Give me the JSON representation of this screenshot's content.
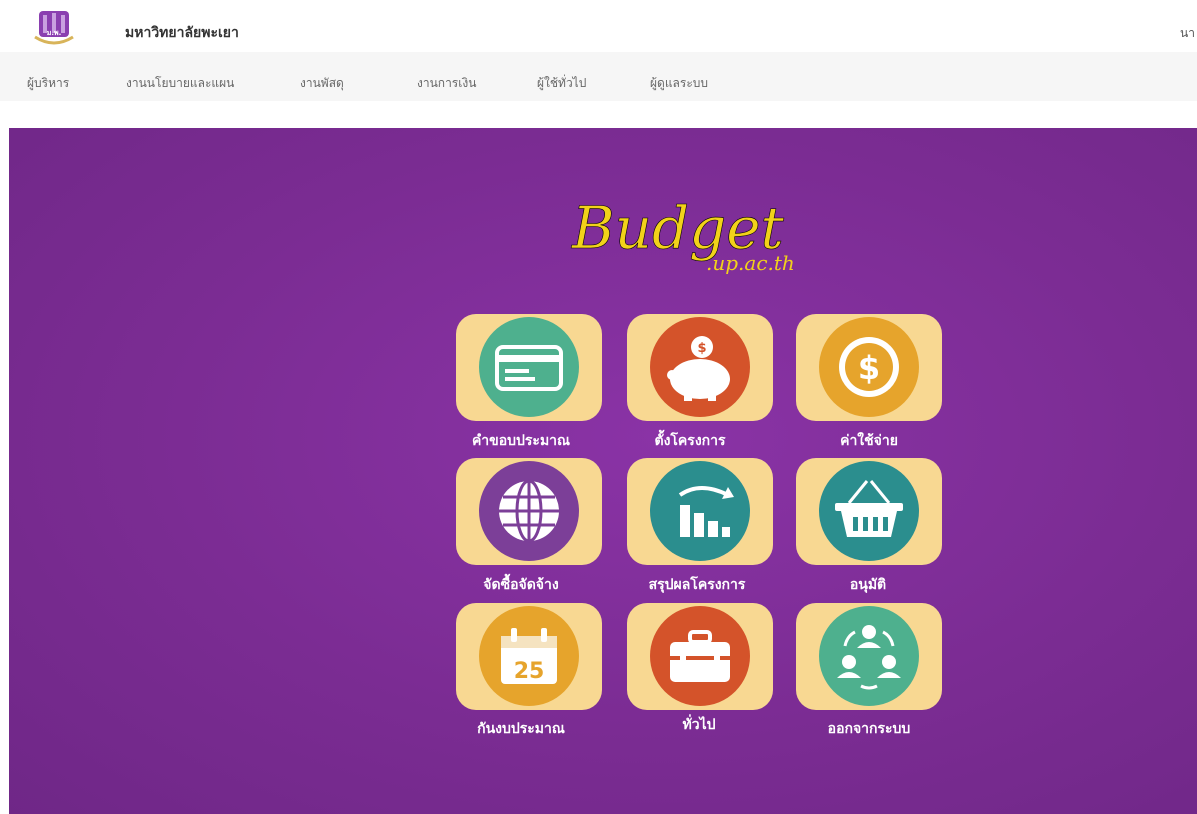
{
  "header": {
    "title": "มหาวิทยาลัยพะเยา",
    "user": "นา"
  },
  "nav": {
    "items": [
      {
        "label": "ผู้บริหาร"
      },
      {
        "label": "งานนโยบายและแผน"
      },
      {
        "label": "งานพัสดุ"
      },
      {
        "label": "งานการเงิน"
      },
      {
        "label": "ผู้ใช้ทั่วไป"
      },
      {
        "label": "ผู้ดูแลระบบ"
      }
    ]
  },
  "brand": {
    "main": "Budget",
    "sub": ".up.ac.th"
  },
  "tiles": [
    {
      "label": "คำขอบประมาณ",
      "icon": "credit-card-icon",
      "color": "#4eb08e"
    },
    {
      "label": "ตั้งโครงการ",
      "icon": "piggy-bank-icon",
      "color": "#d4532a"
    },
    {
      "label": "ค่าใช้จ่าย",
      "icon": "dollar-coin-icon",
      "color": "#e6a42c"
    },
    {
      "label": "จัดซื้อจัดจ้าง",
      "icon": "globe-icon",
      "color": "#7c3f98"
    },
    {
      "label": "สรุปผลโครงการ",
      "icon": "bar-chart-icon",
      "color": "#2b8e8e"
    },
    {
      "label": "อนุมัติ",
      "icon": "basket-icon",
      "color": "#2b8e8e"
    },
    {
      "label": "กันงบประมาณ",
      "icon": "calendar-icon",
      "color": "#e6a42c"
    },
    {
      "label": "ทั่วไป",
      "icon": "toolbox-icon",
      "color": "#d4532a"
    },
    {
      "label": "ออกจากระบบ",
      "icon": "people-cycle-icon",
      "color": "#4eb08e"
    }
  ],
  "calendar_day": "25"
}
